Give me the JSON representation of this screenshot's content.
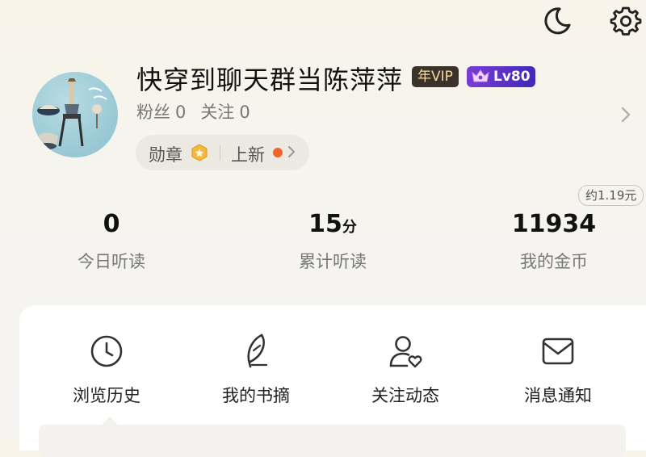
{
  "header": {
    "icons": [
      "moon-icon",
      "gear-icon"
    ]
  },
  "profile": {
    "username": "快穿到聊天群当陈萍萍",
    "vip_badge": "年VIP",
    "level_badge": "Lv80",
    "fans_label": "粉丝",
    "fans_count": "0",
    "following_label": "关注",
    "following_count": "0",
    "medal_label": "勋章",
    "new_label": "上新"
  },
  "coin_value": "约1.19元",
  "stats": [
    {
      "value": "0",
      "unit": "",
      "label": "今日听读"
    },
    {
      "value": "15",
      "unit": "分",
      "label": "累计听读"
    },
    {
      "value": "11934",
      "unit": "",
      "label": "我的金币"
    }
  ],
  "entries": [
    {
      "label": "浏览历史",
      "icon": "clock-icon"
    },
    {
      "label": "我的书摘",
      "icon": "quill-icon"
    },
    {
      "label": "关注动态",
      "icon": "user-heart-icon"
    },
    {
      "label": "消息通知",
      "icon": "mail-icon"
    }
  ],
  "colors": {
    "accent_orange": "#f0632b",
    "vip_bg": "#3b332a",
    "vip_text": "#f4d9a8",
    "level_bg": "#7b3bd6"
  }
}
